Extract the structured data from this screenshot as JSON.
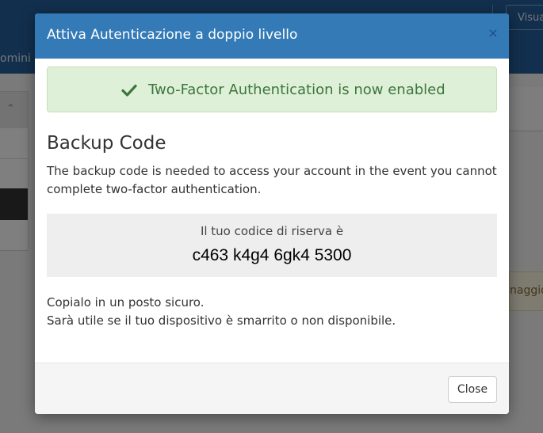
{
  "background": {
    "top_button": "Visua",
    "nav_partial": "omini",
    "alert_partial": "naggio"
  },
  "modal": {
    "title": "Attiva Autenticazione a doppio livello",
    "close_symbol": "×",
    "success_message": "Two-Factor Authentication is now enabled",
    "backup_heading": "Backup Code",
    "backup_description": "The backup code is needed to access your account in the event you cannot complete two-factor authentication.",
    "code_label": "Il tuo codice di riserva è",
    "code_value": "c463 k4g4 6gk4 5300",
    "note_line1": "Copialo in un posto sicuro.",
    "note_line2": "Sarà utile se il tuo dispositivo è smarrito o non disponibile.",
    "close_button": "Close"
  },
  "colors": {
    "header": "#337ab7",
    "success_bg": "#dff0d8",
    "success_text": "#3c763d",
    "code_box_bg": "#eeeeee"
  },
  "icons": {
    "success": "check-icon",
    "close": "close-icon",
    "sidebar": "chevron-up-icon"
  }
}
